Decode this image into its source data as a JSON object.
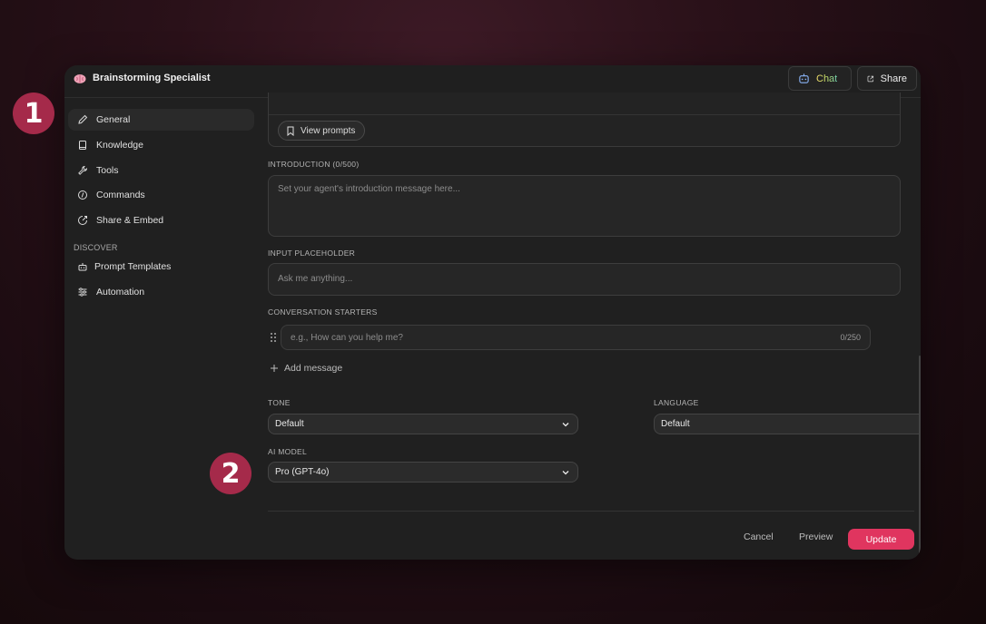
{
  "app": {
    "title": "Brainstorming Specialist",
    "chat_label": "Chat",
    "share_label": "Share"
  },
  "sidebar": {
    "items": [
      {
        "label": "General",
        "icon": "pencil-icon",
        "active": true
      },
      {
        "label": "Knowledge",
        "icon": "book-icon"
      },
      {
        "label": "Tools",
        "icon": "wrench-icon"
      },
      {
        "label": "Commands",
        "icon": "command-icon"
      },
      {
        "label": "Share & Embed",
        "icon": "share-embed-icon"
      }
    ],
    "discover_label": "DISCOVER",
    "discover_items": [
      {
        "label": "Prompt Templates",
        "icon": "robot-icon"
      },
      {
        "label": "Automation",
        "icon": "automation-icon"
      }
    ]
  },
  "form": {
    "view_prompts_label": "View prompts",
    "introduction_label": "INTRODUCTION (0/500)",
    "introduction_placeholder": "Set your agent's introduction message here...",
    "input_placeholder_label": "INPUT PLACEHOLDER",
    "input_placeholder_value": "Ask me anything...",
    "starters_label": "CONVERSATION STARTERS",
    "starter_placeholder": "e.g., How can you help me?",
    "starter_count": "0/250",
    "add_message_label": "Add message",
    "tone_label": "TONE",
    "tone_value": "Default",
    "language_label": "LANGUAGE",
    "language_value": "Default",
    "model_label": "AI MODEL",
    "model_value": "Pro (GPT-4o)"
  },
  "footer": {
    "cancel_label": "Cancel",
    "preview_label": "Preview",
    "update_label": "Update"
  },
  "badges": {
    "one": "1",
    "two": "2"
  },
  "colors": {
    "accent": "#e0355f",
    "badge": "#a52a4a",
    "panel": "#202020"
  }
}
